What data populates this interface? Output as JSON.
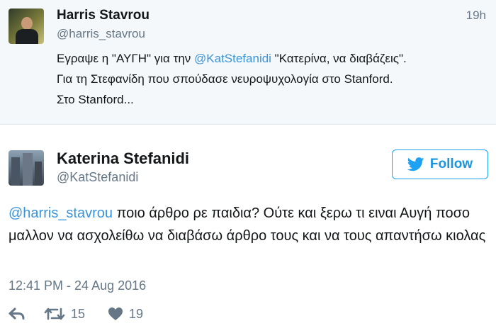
{
  "tweet1": {
    "name": "Harris Stavrou",
    "handle": "@harris_stavrou",
    "time": "19h",
    "line1_pre": "Εγραψε η \"ΑΥΓΗ\" για την ",
    "line1_mention": "@KatStefanidi",
    "line1_post": " \"Κατερίνα, να διαβάζεις\".",
    "line2": "Για τη Στεφανίδη που σπούδασε νευροψυχολογία στο Stanford.",
    "line3": "Στο Stanford..."
  },
  "tweet2": {
    "name": "Katerina Stefanidi",
    "handle": "@KatStefanidi",
    "follow_label": "Follow",
    "text_mention": "@harris_stavrou",
    "text_rest": " ποιο άρθρο ρε παιδια? Ούτε και ξερω τι ειναι Αυγή ποσο μαλλον να ασχολείθω να διαβάσω άρθρο τους και να τους απαντήσω κιολας",
    "date": "12:41 PM - 24 Aug 2016",
    "retweets": "15",
    "likes": "19"
  },
  "colors": {
    "mention": "#3b94d9",
    "follow": "#1da1f2",
    "muted": "#657786",
    "top_bg": "#f5f8fa"
  },
  "icons": [
    "reply-icon",
    "retweet-icon",
    "heart-icon",
    "twitter-bird-icon"
  ]
}
